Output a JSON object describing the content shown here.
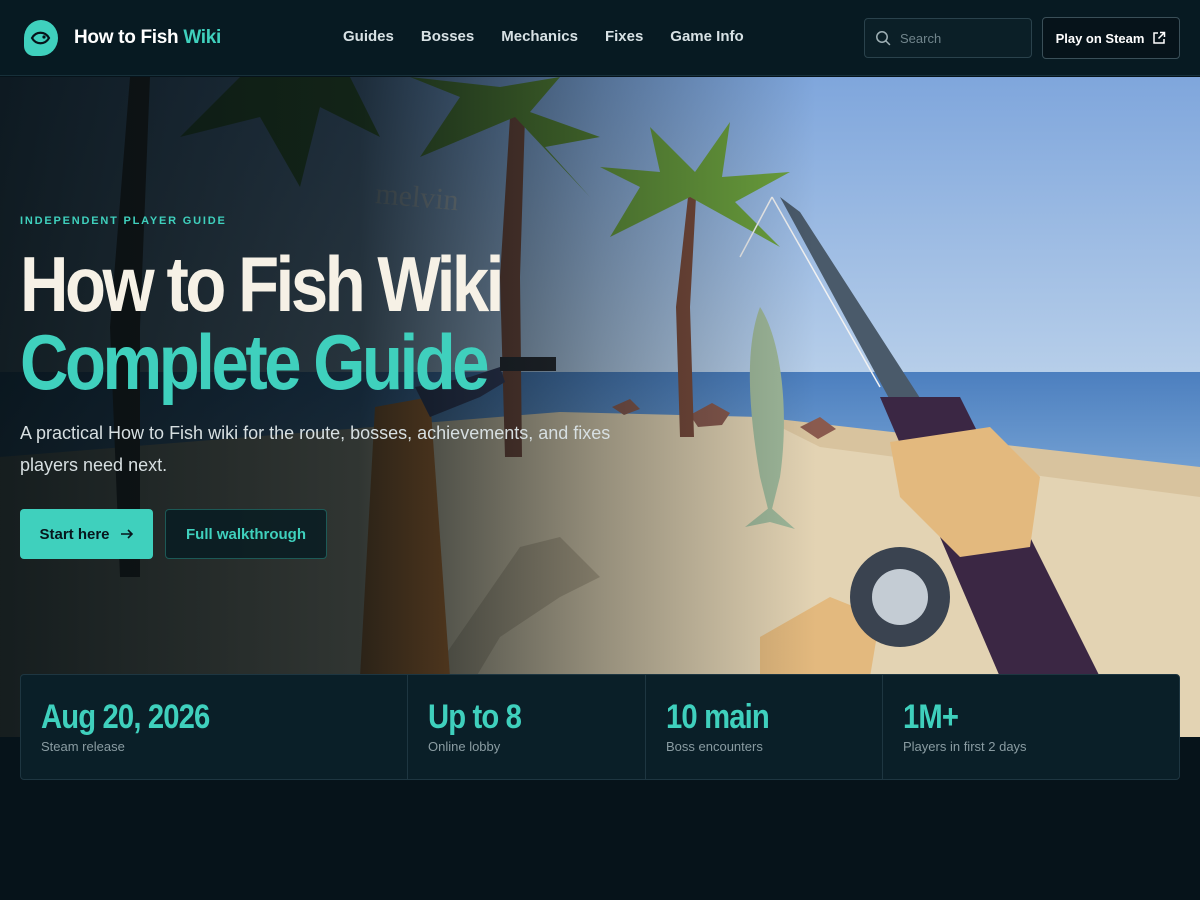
{
  "brand": {
    "name": "How to Fish",
    "accent": "Wiki",
    "logo_icon": "fish-icon"
  },
  "nav": [
    "Guides",
    "Bosses",
    "Mechanics",
    "Fixes",
    "Game Info"
  ],
  "search": {
    "placeholder": "Search"
  },
  "header_cta": {
    "label": "Play on Steam",
    "icon": "external-link-icon"
  },
  "hero": {
    "eyebrow": "INDEPENDENT PLAYER GUIDE",
    "title_line1": "How to Fish Wiki",
    "title_line2": "Complete Guide",
    "lede": "A practical How to Fish wiki for the route, bosses, achievements, and fixes players need next.",
    "primary_cta": "Start here",
    "secondary_cta": "Full walkthrough",
    "art_caption": "melvin"
  },
  "stats": [
    {
      "value": "Aug 20, 2026",
      "label": "Steam release"
    },
    {
      "value": "Up to 8",
      "label": "Online lobby"
    },
    {
      "value": "10 main",
      "label": "Boss encounters"
    },
    {
      "value": "1M+",
      "label": "Players in first 2 days"
    }
  ],
  "colors": {
    "accent": "#3fd0bd",
    "background": "#06131a",
    "header": "#071a22",
    "title_light": "#f6f1e6"
  }
}
